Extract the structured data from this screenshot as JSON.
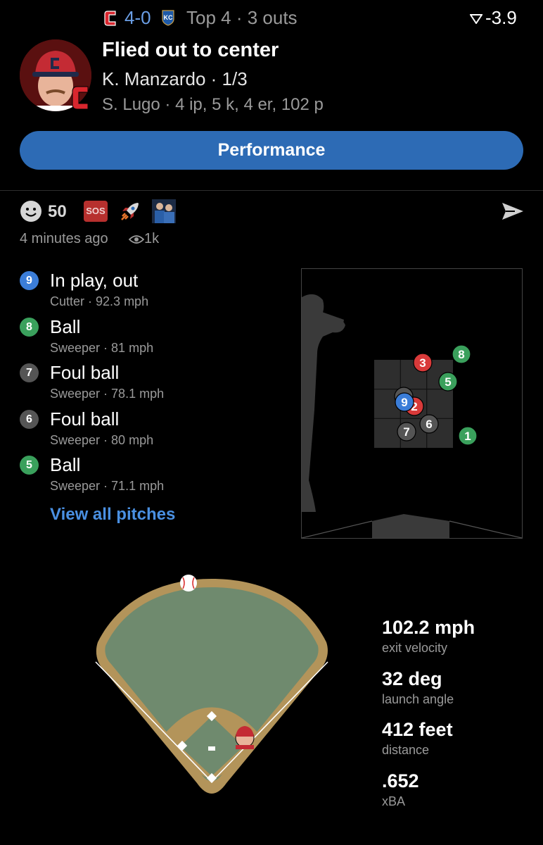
{
  "header": {
    "score": "4-0",
    "inning": "Top 4 · 3 outs",
    "wpa": "-3.9",
    "headline": "Flied out to center",
    "batter": "K. Manzardo · 1/3",
    "pitcher": "S. Lugo · 4 ip, 5 k, 4 er, 102 p"
  },
  "performance_button": "Performance",
  "social": {
    "reaction_count": "50",
    "sos_label": "SOS",
    "time_ago": "4 minutes ago",
    "views": "1k"
  },
  "pitches": [
    {
      "num": "9",
      "result": "In play, out",
      "type": "Cutter",
      "speed": "92.3 mph",
      "color": "#3b7dd8"
    },
    {
      "num": "8",
      "result": "Ball",
      "type": "Sweeper",
      "speed": "81 mph",
      "color": "#3aa05c"
    },
    {
      "num": "7",
      "result": "Foul ball",
      "type": "Sweeper",
      "speed": "78.1 mph",
      "color": "#555555"
    },
    {
      "num": "6",
      "result": "Foul ball",
      "type": "Sweeper",
      "speed": "80 mph",
      "color": "#555555"
    },
    {
      "num": "5",
      "result": "Ball",
      "type": "Sweeper",
      "speed": "71.1 mph",
      "color": "#3aa05c"
    }
  ],
  "pitch_list_separator": " · ",
  "view_all": "View all pitches",
  "zone_markers": [
    {
      "num": "3",
      "color": "#d93a3a"
    },
    {
      "num": "8",
      "color": "#3aa05c"
    },
    {
      "num": "5",
      "color": "#3aa05c"
    },
    {
      "num": "4",
      "color": "#555555"
    },
    {
      "num": "2",
      "color": "#d93a3a"
    },
    {
      "num": "9",
      "color": "#3b7dd8"
    },
    {
      "num": "7",
      "color": "#555555"
    },
    {
      "num": "6",
      "color": "#555555"
    },
    {
      "num": "1",
      "color": "#3aa05c"
    }
  ],
  "stats": [
    {
      "value": "102.2 mph",
      "label": "exit velocity"
    },
    {
      "value": "32 deg",
      "label": "launch angle"
    },
    {
      "value": "412 feet",
      "label": "distance"
    },
    {
      "value": ".652",
      "label": "xBA"
    }
  ],
  "colors": {
    "accent_blue": "#2d6bb5",
    "link_blue": "#4a90e2",
    "score_blue": "#6b9fe6",
    "grass": "#6f8a6e",
    "dirt": "#b3945a"
  }
}
